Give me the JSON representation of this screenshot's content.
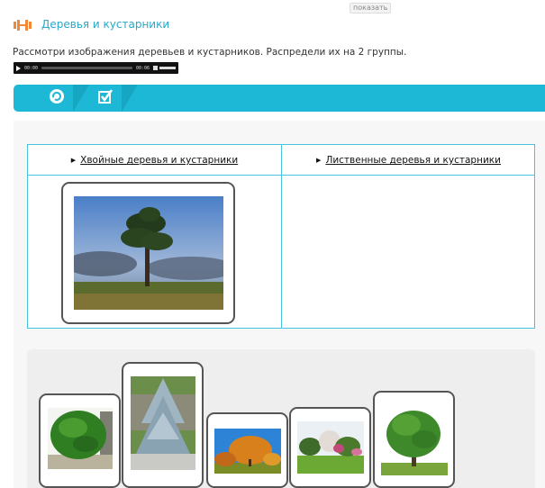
{
  "top_hint": "показать",
  "header": {
    "title": "Деревья и кустарники",
    "logo_icon": "dumbbell-icon",
    "accent": "#f08a3a"
  },
  "instruction": "Рассмотри изображения деревьев и кустарников. Распредели их на 2 группы.",
  "audio": {
    "current_time": "00:00",
    "duration": "00:06",
    "progress": 0
  },
  "toolbar": {
    "color": "#1cb8d6",
    "buttons": [
      {
        "icon": "refresh-icon"
      },
      {
        "icon": "checkbox-check-icon"
      }
    ]
  },
  "table": {
    "columns": [
      {
        "label": "Хвойные деревья и кустарники"
      },
      {
        "label": "Лиственные деревья и кустарники"
      }
    ],
    "placed_left": [
      {
        "image": "pine-tree-photo"
      }
    ],
    "placed_right": []
  },
  "tray": {
    "cards": [
      {
        "image": "round-shrub-photo"
      },
      {
        "image": "blue-spruce-photo"
      },
      {
        "image": "autumn-tree-photo"
      },
      {
        "image": "park-trees-photo"
      },
      {
        "image": "deciduous-tree-photo"
      }
    ]
  }
}
